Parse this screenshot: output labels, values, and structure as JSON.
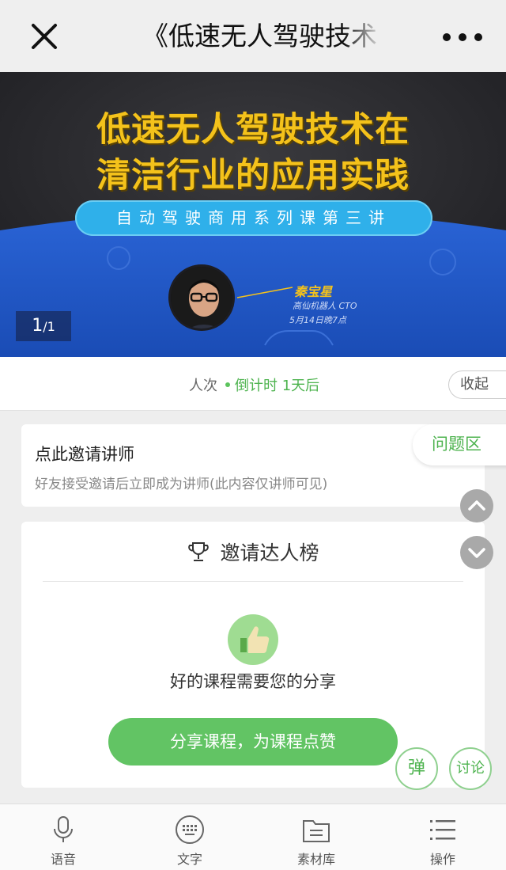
{
  "header": {
    "title": "《低速无人驾驶技术",
    "close_icon": "close-icon",
    "more_icon": "more-icon"
  },
  "banner": {
    "title_line1": "低速无人驾驶技术在",
    "title_line2": "清洁行业的应用实践",
    "series": "自动驾驶商用系列课第三讲",
    "speaker_name": "秦宝星",
    "speaker_org": "高仙机器人 CTO",
    "speaker_time": "5月14日晚7点",
    "page_current": "1",
    "page_total": "/1",
    "colors": {
      "title": "#f4c21b",
      "pill": "#2fb0ea",
      "blue": "#1f56c4"
    }
  },
  "status": {
    "views_label": "人次",
    "countdown": "倒计时 1天后",
    "collapse_label": "收起"
  },
  "invite": {
    "title": "点此邀请讲师",
    "subtitle": "好友接受邀请后立即成为讲师(此内容仅讲师可见)",
    "qa_label": "问题区"
  },
  "leaderboard": {
    "title": "邀请达人榜",
    "trophy_icon": "trophy-icon",
    "empty_text": "好的课程需要您的分享",
    "share_button": "分享课程，为课程点赞"
  },
  "floating": {
    "danmu_label": "弹",
    "discuss_label": "讨论"
  },
  "bottom_nav": [
    {
      "label": "语音",
      "icon": "microphone-icon"
    },
    {
      "label": "文字",
      "icon": "keyboard-icon"
    },
    {
      "label": "素材库",
      "icon": "folder-icon"
    },
    {
      "label": "操作",
      "icon": "list-icon"
    }
  ],
  "accent_color": "#4db34e"
}
